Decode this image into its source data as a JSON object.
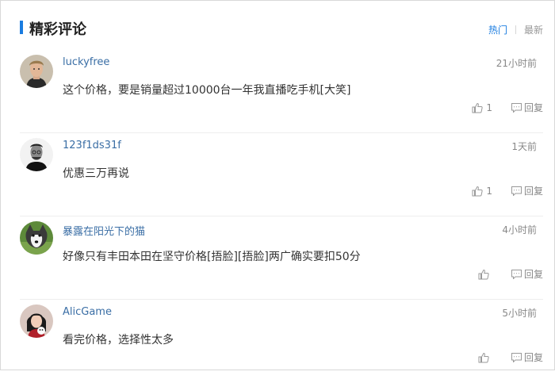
{
  "section": {
    "title": "精彩评论",
    "tabs": {
      "hot": "热门",
      "latest": "最新"
    },
    "accent": "#1a7ce0"
  },
  "comments": [
    {
      "user": "luckyfree",
      "time": "21小时前",
      "text": "这个价格，要是销量超过10000台一年我直播吃手机[大笑]",
      "likes": "1",
      "reply": "回复",
      "avatar": "portrait-man-blond"
    },
    {
      "user": "123f1ds31f",
      "time": "1天前",
      "text": "优惠三万再说",
      "likes": "1",
      "reply": "回复",
      "avatar": "portrait-man-bw"
    },
    {
      "user": "暴露在阳光下的猫",
      "time": "4小时前",
      "text": "好像只有丰田本田在坚守价格[捂脸][捂脸]两广确实要扣50分",
      "likes": "",
      "reply": "回复",
      "avatar": "husky-dog"
    },
    {
      "user": "AlicGame",
      "time": "5小时前",
      "text": "看完价格，选择性太多",
      "likes": "",
      "reply": "回复",
      "avatar": "girl-with-toy"
    }
  ]
}
